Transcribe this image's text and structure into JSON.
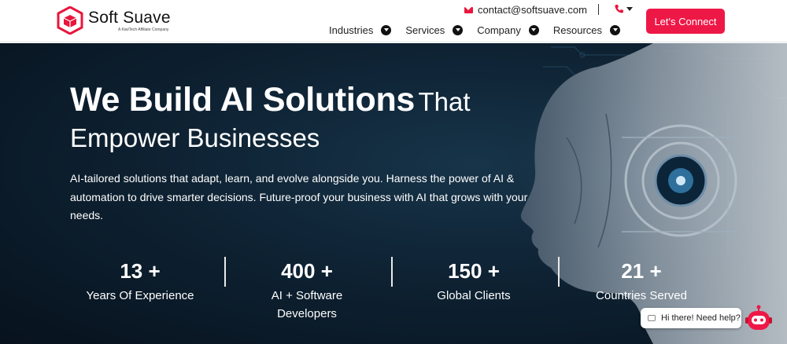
{
  "brand": {
    "name": "Soft Suave",
    "tagline": "A KiwiTech Affiliate Company",
    "accent": "#ee1847"
  },
  "header": {
    "email": "contact@softsuave.com",
    "phone_icon": "phone-icon",
    "nav": [
      {
        "label": "Industries"
      },
      {
        "label": "Services"
      },
      {
        "label": "Company"
      },
      {
        "label": "Resources"
      }
    ],
    "cta": "Let's Connect"
  },
  "hero": {
    "title_strong": "We Build AI Solutions",
    "title_light": "That",
    "title_line2": "Empower Businesses",
    "description": "AI-tailored solutions that adapt, learn, and evolve alongside you. Harness the power of AI & automation to drive smarter decisions. Future-proof your business with AI that grows with your needs.",
    "stats": [
      {
        "value": "13 +",
        "label": "Years Of Experience"
      },
      {
        "value": "400 +",
        "label": "AI + Software Developers"
      },
      {
        "value": "150 +",
        "label": "Global Clients"
      },
      {
        "value": "21 +",
        "label": "Countries Served"
      }
    ]
  },
  "chat": {
    "greeting": "Hi there! Need help?"
  }
}
